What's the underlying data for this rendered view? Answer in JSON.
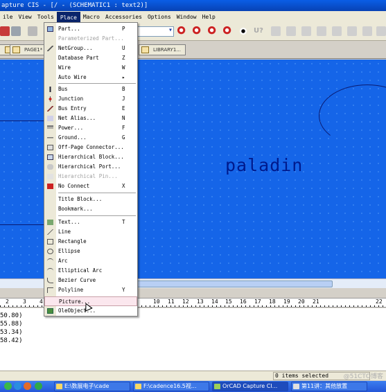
{
  "window": {
    "title": "apture CIS - [/ - (SCHEMATIC1 : text2)]"
  },
  "menubar": {
    "items": [
      {
        "label": "ile"
      },
      {
        "label": "View"
      },
      {
        "label": "Tools"
      },
      {
        "label": "Place"
      },
      {
        "label": "Macro"
      },
      {
        "label": "Accessories"
      },
      {
        "label": "Options"
      },
      {
        "label": "Window"
      },
      {
        "label": "Help"
      }
    ]
  },
  "toolbar": {
    "zoom_select_value": "",
    "u_label": "U?"
  },
  "tabs": [
    {
      "label": ""
    },
    {
      "label": "PAGE1*"
    },
    {
      "label": "LIBRARY1..."
    }
  ],
  "place_menu": {
    "items": [
      {
        "label": "Part...",
        "shortcut": "P",
        "icon": "part-icon",
        "disabled": false
      },
      {
        "label": "Parameterized Part...",
        "shortcut": "",
        "icon": "",
        "disabled": true
      },
      {
        "label": "NetGroup...",
        "shortcut": "U",
        "icon": "netgroup-icon",
        "disabled": false
      },
      {
        "label": "Database Part",
        "shortcut": "Z",
        "icon": "",
        "disabled": false
      },
      {
        "label": "Wire",
        "shortcut": "W",
        "icon": "",
        "disabled": false
      },
      {
        "label": "Auto Wire",
        "shortcut": "▸",
        "icon": "",
        "disabled": false
      },
      {
        "label": "Bus",
        "shortcut": "B",
        "icon": "bus-icon",
        "disabled": false
      },
      {
        "label": "Junction",
        "shortcut": "J",
        "icon": "junction-icon",
        "disabled": false
      },
      {
        "label": "Bus Entry",
        "shortcut": "E",
        "icon": "bus-entry-icon",
        "disabled": false
      },
      {
        "label": "Net Alias...",
        "shortcut": "N",
        "icon": "net-alias-icon",
        "disabled": false
      },
      {
        "label": "Power...",
        "shortcut": "F",
        "icon": "power-icon",
        "disabled": false
      },
      {
        "label": "Ground...",
        "shortcut": "G",
        "icon": "ground-icon",
        "disabled": false
      },
      {
        "label": "Off-Page Connector...",
        "shortcut": "",
        "icon": "off-page-connector-icon",
        "disabled": false
      },
      {
        "label": "Hierarchical Block...",
        "shortcut": "",
        "icon": "hierarchical-block-icon",
        "disabled": false
      },
      {
        "label": "Hierarchical Port...",
        "shortcut": "",
        "icon": "hierarchical-port-icon",
        "disabled": false
      },
      {
        "label": "Hierarchical Pin...",
        "shortcut": "",
        "icon": "hierarchical-pin-icon",
        "disabled": true
      },
      {
        "label": "No Connect",
        "shortcut": "X",
        "icon": "no-connect-icon",
        "disabled": false
      },
      {
        "label": "Title Block...",
        "shortcut": "",
        "icon": "",
        "disabled": false
      },
      {
        "label": "Bookmark...",
        "shortcut": "",
        "icon": "",
        "disabled": false
      },
      {
        "label": "Text...",
        "shortcut": "T",
        "icon": "text-icon",
        "disabled": false
      },
      {
        "label": "Line",
        "shortcut": "",
        "icon": "line-icon",
        "disabled": false
      },
      {
        "label": "Rectangle",
        "shortcut": "",
        "icon": "rectangle-icon",
        "disabled": false
      },
      {
        "label": "Ellipse",
        "shortcut": "",
        "icon": "ellipse-icon",
        "disabled": false
      },
      {
        "label": "Arc",
        "shortcut": "",
        "icon": "arc-icon",
        "disabled": false
      },
      {
        "label": "Elliptical Arc",
        "shortcut": "",
        "icon": "elliptical-arc-icon",
        "disabled": false
      },
      {
        "label": "Bezier Curve",
        "shortcut": "",
        "icon": "bezier-curve-icon",
        "disabled": false
      },
      {
        "label": "Polyline",
        "shortcut": "Y",
        "icon": "polyline-icon",
        "disabled": false
      },
      {
        "label": "Picture...",
        "shortcut": "",
        "icon": "",
        "disabled": false
      },
      {
        "label": "OleObject...",
        "shortcut": "",
        "icon": "ole-object-icon",
        "disabled": false
      }
    ]
  },
  "canvas": {
    "text": "paladin"
  },
  "ruler": {
    "numbers": [
      "2",
      "3",
      "4",
      "10",
      "11",
      "12",
      "13",
      "14",
      "15",
      "16",
      "17",
      "18",
      "19",
      "20",
      "21",
      "22"
    ]
  },
  "log": {
    "lines": [
      "50.80)",
      "55.88)",
      "53.34)",
      "58.42)"
    ]
  },
  "status": {
    "selected": "0 items selected"
  },
  "taskbar": {
    "tasks": [
      {
        "label": "E:\\数展电子\\cade"
      },
      {
        "label": "F:\\cadence16.5视..."
      },
      {
        "label": "OrCAD Capture CI..."
      },
      {
        "label": "第11讲：其他放置"
      }
    ]
  },
  "watermark": "@51CTO博客",
  "colors": {
    "canvas_bg": "#1565e8",
    "canvas_text": "#001a8c",
    "menu_highlight": "#fbe7ee",
    "titlebar": "#0a5ee6"
  }
}
